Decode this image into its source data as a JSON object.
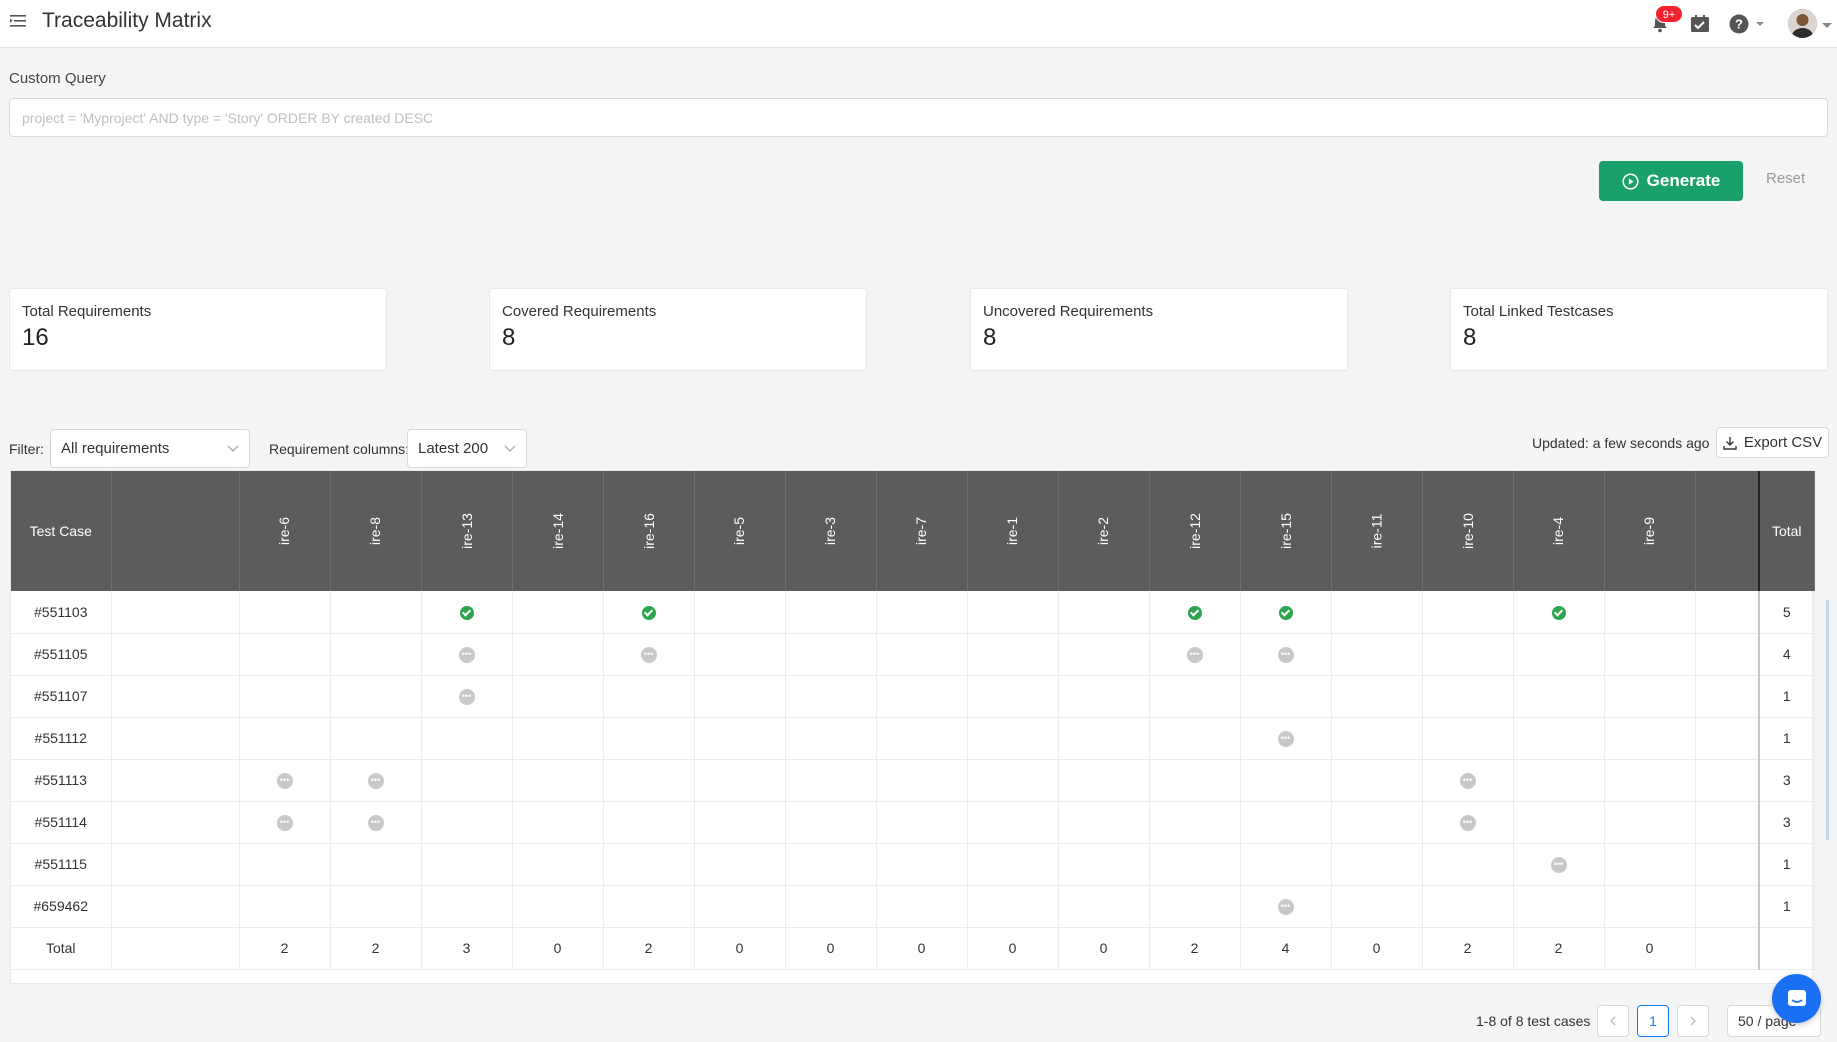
{
  "header": {
    "title": "Traceability Matrix",
    "notification_badge": "9+"
  },
  "query": {
    "label": "Custom Query",
    "placeholder": "project = 'Myproject' AND type = 'Story' ORDER BY created DESC",
    "generate_label": "Generate",
    "reset_label": "Reset"
  },
  "stats": [
    {
      "label": "Total Requirements",
      "value": "16"
    },
    {
      "label": "Covered Requirements",
      "value": "8"
    },
    {
      "label": "Uncovered Requirements",
      "value": "8"
    },
    {
      "label": "Total Linked Testcases",
      "value": "8"
    }
  ],
  "toolbar": {
    "filter_label": "Filter:",
    "filter_value": "All requirements",
    "columns_label": "Requirement columns:",
    "columns_value": "Latest 200",
    "updated": "Updated: a few seconds ago",
    "export_label": "Export CSV"
  },
  "table": {
    "first_header": "Test Case",
    "total_header": "Total",
    "requirements": [
      "ire-6",
      "ire-8",
      "ire-13",
      "ire-14",
      "ire-16",
      "ire-5",
      "ire-3",
      "ire-7",
      "ire-1",
      "ire-2",
      "ire-12",
      "ire-15",
      "ire-11",
      "ire-10",
      "ire-4",
      "ire-9"
    ],
    "rows": [
      {
        "id": "#551103",
        "cells": [
          "",
          "",
          "ok",
          "",
          "ok",
          "",
          "",
          "",
          "",
          "",
          "ok",
          "ok",
          "",
          "",
          "ok",
          ""
        ],
        "total": "5"
      },
      {
        "id": "#551105",
        "cells": [
          "",
          "",
          "pend",
          "",
          "pend",
          "",
          "",
          "",
          "",
          "",
          "pend",
          "pend",
          "",
          "",
          "",
          ""
        ],
        "total": "4"
      },
      {
        "id": "#551107",
        "cells": [
          "",
          "",
          "pend",
          "",
          "",
          "",
          "",
          "",
          "",
          "",
          "",
          "",
          "",
          "",
          "",
          ""
        ],
        "total": "1"
      },
      {
        "id": "#551112",
        "cells": [
          "",
          "",
          "",
          "",
          "",
          "",
          "",
          "",
          "",
          "",
          "",
          "pend",
          "",
          "",
          "",
          ""
        ],
        "total": "1"
      },
      {
        "id": "#551113",
        "cells": [
          "pend",
          "pend",
          "",
          "",
          "",
          "",
          "",
          "",
          "",
          "",
          "",
          "",
          "",
          "pend",
          "",
          ""
        ],
        "total": "3"
      },
      {
        "id": "#551114",
        "cells": [
          "pend",
          "pend",
          "",
          "",
          "",
          "",
          "",
          "",
          "",
          "",
          "",
          "",
          "",
          "pend",
          "",
          ""
        ],
        "total": "3"
      },
      {
        "id": "#551115",
        "cells": [
          "",
          "",
          "",
          "",
          "",
          "",
          "",
          "",
          "",
          "",
          "",
          "",
          "",
          "",
          "pend",
          ""
        ],
        "total": "1"
      },
      {
        "id": "#659462",
        "cells": [
          "",
          "",
          "",
          "",
          "",
          "",
          "",
          "",
          "",
          "",
          "",
          "pend",
          "",
          "",
          "",
          ""
        ],
        "total": "1"
      }
    ],
    "footer_label": "Total",
    "column_totals": [
      "2",
      "2",
      "3",
      "0",
      "2",
      "0",
      "0",
      "0",
      "0",
      "0",
      "2",
      "4",
      "0",
      "2",
      "2",
      "0"
    ]
  },
  "pagination": {
    "summary": "1-8 of 8 test cases",
    "current_page": "1",
    "page_size": "50 / page"
  }
}
